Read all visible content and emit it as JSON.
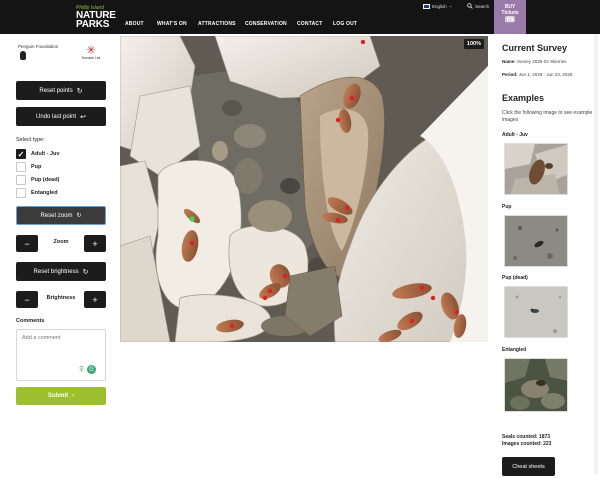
{
  "nav": {
    "logo": {
      "line1": "Phillip Island",
      "line2": "NATURE",
      "line3": "PARKS"
    },
    "links": [
      "ABOUT",
      "WHAT'S ON",
      "ATTRACTIONS",
      "CONSERVATION",
      "CONTACT",
      "LOG OUT"
    ],
    "language": "English",
    "search": "Search",
    "buy": {
      "line1": "BUY",
      "line2": "Tickets"
    }
  },
  "sponsors": {
    "penguin_foundation": "Penguin Foundation",
    "monash": "Monash Uni"
  },
  "controls": {
    "reset_points": "Reset points",
    "undo_last_point": "Undo last point",
    "select_type_label": "Select type:",
    "types": [
      {
        "label": "Adult - Juv",
        "checked": true
      },
      {
        "label": "Pup",
        "checked": false
      },
      {
        "label": "Pup (dead)",
        "checked": false
      },
      {
        "label": "Entangled",
        "checked": false
      }
    ],
    "reset_zoom": "Reset zoom",
    "zoom_label": "Zoom",
    "reset_brightness": "Reset brightness",
    "brightness_label": "Brightness",
    "minus": "−",
    "plus": "+",
    "comments_label": "Comments",
    "comment_placeholder": "Add a comment",
    "submit": "Submit"
  },
  "image": {
    "zoom": "100%"
  },
  "survey": {
    "title": "Current Survey",
    "name_label": "Name:",
    "name": "Survey 2026-02 Skerries",
    "period_label": "Period:",
    "period": "Jun 1, 2026 - Jun 23, 2026"
  },
  "examples": {
    "title": "Examples",
    "description": "Click the following image to see example images",
    "items": [
      "Adult - Juv",
      "Pup",
      "Pup (dead)",
      "Entangled"
    ]
  },
  "stats": {
    "seals_counted_label": "Seals counted:",
    "seals_counted": "1873",
    "images_counted_label": "Images counted:",
    "images_counted": "223"
  },
  "cheat_sheets": "Cheat sheets",
  "colors": {
    "accent_green": "#9bbf2e",
    "buy_purple": "#9a7aa8",
    "point_red": "#e41e1e",
    "dark": "#1c1c1c"
  }
}
